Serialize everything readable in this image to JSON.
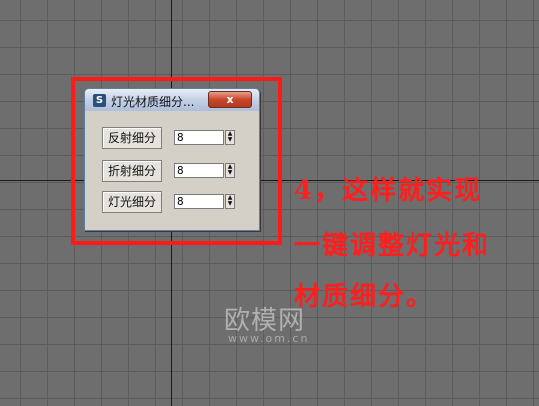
{
  "dialog": {
    "title": "灯光材质细分...",
    "close_label": "x",
    "app_icon_glyph": "S",
    "rows": [
      {
        "label": "反射细分",
        "value": "8"
      },
      {
        "label": "折射细分",
        "value": "8"
      },
      {
        "label": "灯光细分",
        "value": "8"
      }
    ]
  },
  "caption": {
    "line1": "4，这样就实现",
    "line2": "一键调整灯光和",
    "line3": "材质细分。"
  },
  "watermark": {
    "main": "欧模网",
    "url": "www.om.cn"
  },
  "colors": {
    "highlight": "#ff1a1a",
    "caption": "#ff1e1e",
    "viewport_bg": "#6e6e6e"
  },
  "icons": {
    "app": "3dsmax-icon",
    "spinner_up": "arrow-up-icon",
    "spinner_down": "arrow-down-icon"
  }
}
